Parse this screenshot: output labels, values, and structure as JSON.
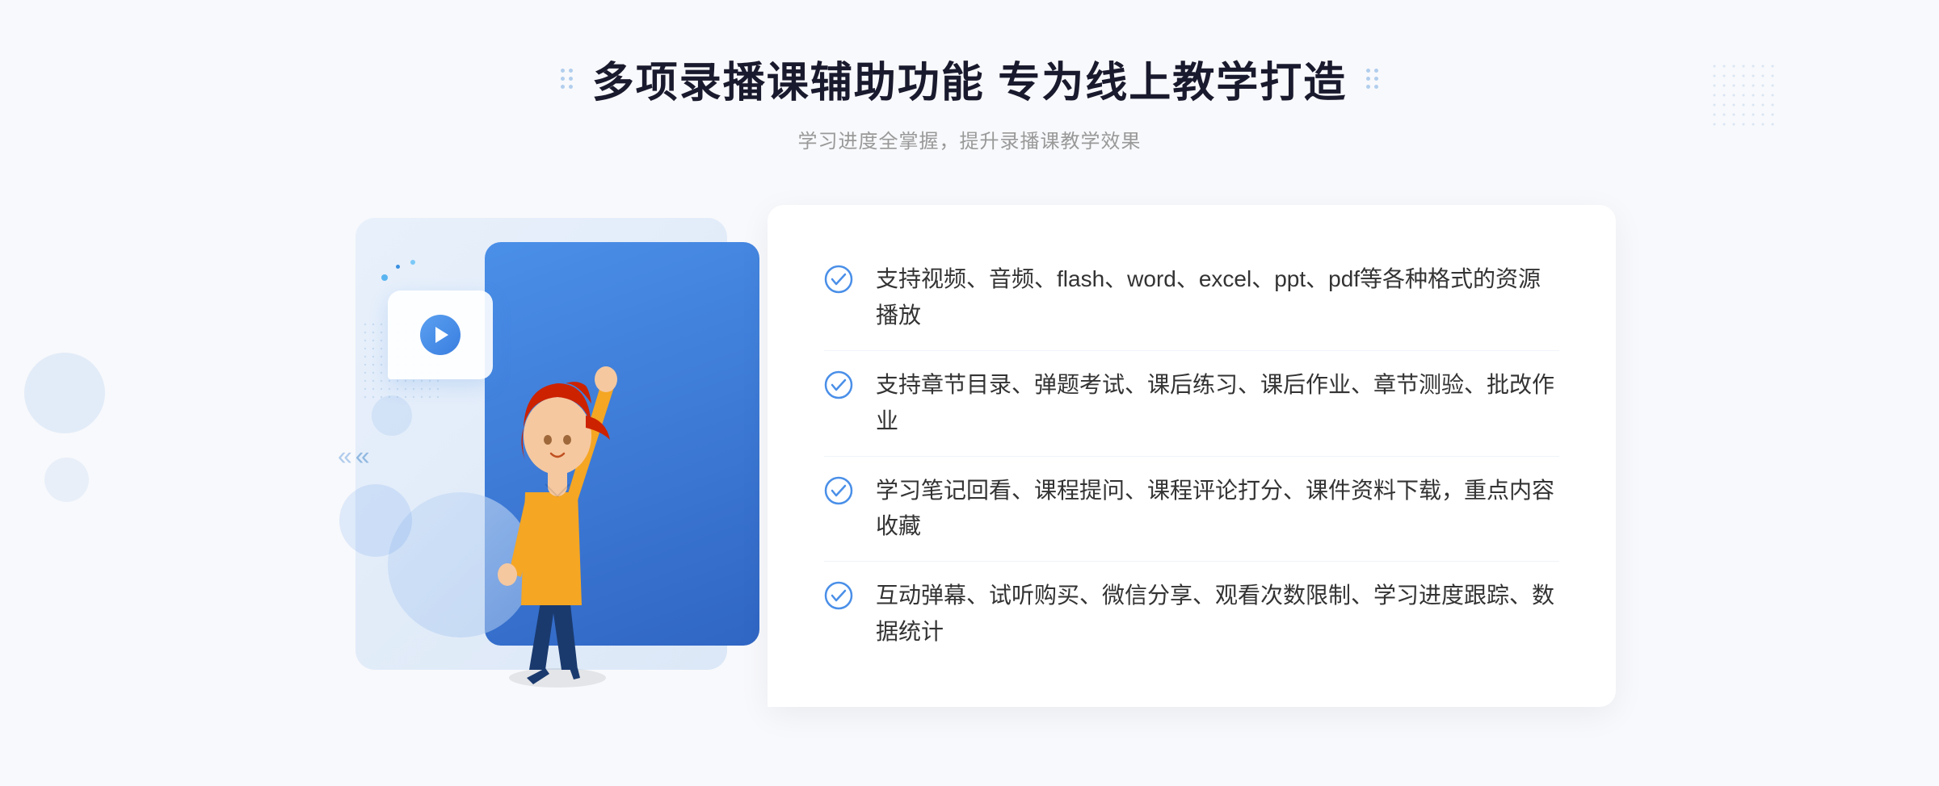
{
  "header": {
    "title": "多项录播课辅助功能 专为线上教学打造",
    "subtitle": "学习进度全掌握，提升录播课教学效果"
  },
  "features": [
    {
      "id": "feature-1",
      "text": "支持视频、音频、flash、word、excel、ppt、pdf等各种格式的资源播放"
    },
    {
      "id": "feature-2",
      "text": "支持章节目录、弹题考试、课后练习、课后作业、章节测验、批改作业"
    },
    {
      "id": "feature-3",
      "text": "学习笔记回看、课程提问、课程评论打分、课件资料下载，重点内容收藏"
    },
    {
      "id": "feature-4",
      "text": "互动弹幕、试听购买、微信分享、观看次数限制、学习进度跟踪、数据统计"
    }
  ],
  "colors": {
    "accent_blue": "#4a8fe8",
    "dark_blue": "#3066c4",
    "title_color": "#1a1a2e",
    "text_color": "#333333",
    "subtitle_color": "#999999"
  },
  "decorative": {
    "chevron_left": "«",
    "check_symbol": "✓"
  }
}
